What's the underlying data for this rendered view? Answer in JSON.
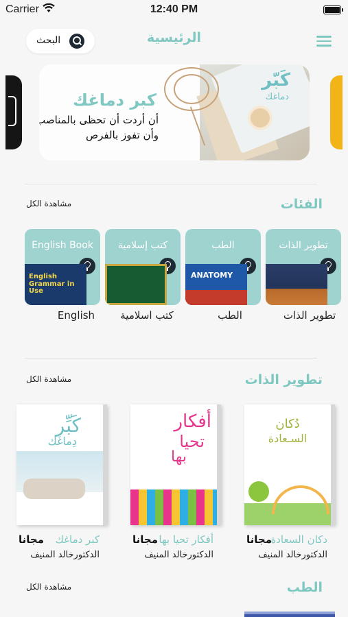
{
  "status_bar": {
    "carrier": "Carrier",
    "time": "12:40 PM"
  },
  "header": {
    "title": "الرئيسية",
    "search_label": "البحث"
  },
  "banner": {
    "title": "كبر دماغك",
    "line1": "أن أردت أن تحظى بالمناصب",
    "line2": "وأن تفوز بالفرص",
    "cover_title": "كَبّر",
    "cover_subtitle": "دماغك"
  },
  "categories_section": {
    "title": "الفئات",
    "see_all": "مشاهدة الكل",
    "items": [
      {
        "name": "تطوير الذات",
        "label": "تطوير الذات"
      },
      {
        "name": "الطب",
        "label": "الطب",
        "cover_text": "ANATOMY"
      },
      {
        "name": "كتب إسلامية",
        "label": "كتب اسلامية"
      },
      {
        "name": "English Book",
        "label": "English",
        "cover_text": "English Grammar in Use"
      }
    ]
  },
  "self_dev_section": {
    "title": "تطوير الذات",
    "see_all": "مشاهدة الكل",
    "books": [
      {
        "title": "دكان السعادة",
        "price": "مجانا",
        "author": "الدكتورخالد المنيف",
        "cover_line1": "دُكان",
        "cover_line2": "السـعادة"
      },
      {
        "title": "أفكار تحيا بها",
        "price": "مجانا",
        "author": "الدكتورخالد المنيف",
        "cover_line1": "أفكار",
        "cover_line2": "تحيا",
        "cover_line3": "بها"
      },
      {
        "title": "كبر دماغك",
        "price": "مجانا",
        "author": "الدكتورخالد المنيف",
        "cover_line1": "كَبِّر",
        "cover_line2": "دِماغَك"
      }
    ]
  },
  "medicine_section": {
    "title": "الطب",
    "see_all": "مشاهدة الكل"
  },
  "colors": {
    "accent": "#7fc7c1",
    "category_bg": "#9fd3cf",
    "dark": "#1e2b34"
  }
}
